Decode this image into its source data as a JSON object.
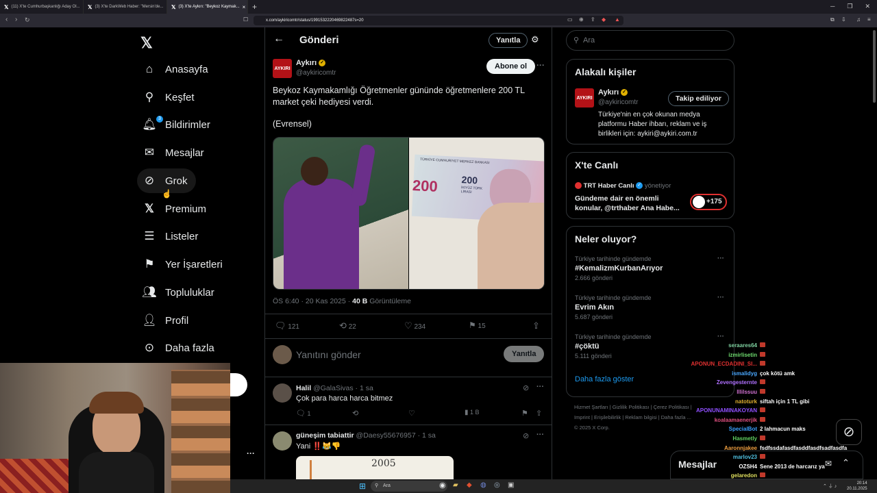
{
  "browser": {
    "tabs": [
      {
        "title": "(11) X'te Cumhurbaşkanlığı Aday Ol..."
      },
      {
        "title": "(3) X'te DarkWeb Haber: \"Mersin'de..."
      },
      {
        "title": "(3) X'te Aykırı: \"Beykoz Kaymak...",
        "active": true
      }
    ],
    "url": "x.com/aykiricomtr/status/1991532220469822487s=20",
    "new_tab": "+"
  },
  "nav": {
    "items": [
      {
        "label": "Anasayfa",
        "icon": "home-icon"
      },
      {
        "label": "Keşfet",
        "icon": "search-icon"
      },
      {
        "label": "Bildirimler",
        "icon": "bell-icon",
        "badge": "3"
      },
      {
        "label": "Mesajlar",
        "icon": "mail-icon"
      },
      {
        "label": "Grok",
        "icon": "grok-icon"
      },
      {
        "label": "Premium",
        "icon": "x-logo-icon"
      },
      {
        "label": "Listeler",
        "icon": "list-icon"
      },
      {
        "label": "Yer İşaretleri",
        "icon": "bookmark-icon"
      },
      {
        "label": "Topluluklar",
        "icon": "community-icon"
      },
      {
        "label": "Profil",
        "icon": "person-icon"
      },
      {
        "label": "Daha fazla",
        "icon": "more-circle-icon"
      }
    ]
  },
  "header": {
    "title": "Gönderi",
    "reply_btn": "Yanıtla"
  },
  "post": {
    "author": "Aykırı",
    "handle": "@aykiricomtr",
    "follow_btn": "Abone ol",
    "text": "Beykoz Kaymakamlığı Öğretmenler gününde öğretmenlere 200 TL market çeki hediyesi verdi.",
    "source": "(Evrensel)",
    "timestamp": "ÖS 6:40 · 20 Kas 2025 · ",
    "views": "40 B",
    "views_label": "Görüntüleme",
    "stats": {
      "replies": "121",
      "reposts": "22",
      "likes": "234",
      "bookmarks": "15"
    },
    "image_banknote_text": "TÜRKİYE CUMHURİYET MERKEZ BANKASI",
    "image_banknote_value": "200",
    "image_banknote_words": "İKİYÜZ TÜRK LİRASI",
    "logo_text": "AYKIRI"
  },
  "compose": {
    "placeholder": "Yanıtını gönder",
    "button": "Yanıtla"
  },
  "replies": [
    {
      "name": "Halil",
      "handle": "@GalaSivas",
      "time": "· 1 sa",
      "text": "Çok para harca harca bitmez",
      "replies": "1",
      "views": "1 B"
    },
    {
      "name": "güneşim tabiattir",
      "handle": "@Daesy55676957",
      "time": "· 1 sa",
      "text": "Yani ‼️😹👎",
      "image_text": "2005"
    }
  ],
  "search": {
    "placeholder": "Ara"
  },
  "related": {
    "title": "Alakalı kişiler",
    "name": "Aykırı",
    "handle": "@aykiricomtr",
    "follow_btn": "Takip ediliyor",
    "bio": "Türkiye'nin en çok okunan medya platformu Haber ihbarı, reklam ve iş birlikleri için: aykiri@aykiri.com.tr"
  },
  "live": {
    "title": "X'te Canlı",
    "host": "TRT Haber Canlı",
    "role": "yönetiyor",
    "text": "Gündeme dair en önemli konular, @trthaber Ana Habe...",
    "count": "+175"
  },
  "trends": {
    "title": "Neler oluyor?",
    "items": [
      {
        "sub": "Türkiye tarihinde gündemde",
        "title": "#KemalizmKurbanArıyor",
        "count": "2.666 gönderi"
      },
      {
        "sub": "Türkiye tarihinde gündemde",
        "title": "Evrim Akın",
        "count": "5.687 gönderi"
      },
      {
        "sub": "Türkiye tarihinde gündemde",
        "title": "#çöktü",
        "count": "5.111 gönderi"
      }
    ],
    "more": "Daha fazla göster"
  },
  "footer": {
    "links": [
      "Hizmet Şartları",
      "Gizlilik Politikası",
      "Çerez Politikası",
      "Imprint",
      "Erişilebilirlik",
      "Reklam bilgisi",
      "Daha fazla ..."
    ],
    "copyright": "© 2025 X Corp."
  },
  "messages_bar": {
    "label": "Mesajlar"
  },
  "chat": [
    {
      "name": "seraares64",
      "msg": "",
      "color": "#7fd1a0"
    },
    {
      "name": "izmirlisetin",
      "msg": "",
      "color": "#6fdc6f"
    },
    {
      "name": "APONUN_ECDADINI_SI...",
      "msg": "",
      "color": "#e03030"
    },
    {
      "name": "ismalidyg",
      "msg": "çok kötü amk",
      "color": "#4aa8ff"
    },
    {
      "name": "Zevengesternte",
      "msg": "",
      "color": "#b070ff"
    },
    {
      "name": "lllilssuu",
      "msg": "",
      "color": "#d070d0"
    },
    {
      "name": "natoturk",
      "msg": "siftah için 1 TL gibi",
      "color": "#e0b030"
    },
    {
      "name": "APONUNAMINAKOYAN",
      "msg": "",
      "color": "#9050ff"
    },
    {
      "name": "koalaamaenerjik",
      "msg": "",
      "color": "#e05080"
    },
    {
      "name": "SpecialBot",
      "msg": "2 lahmacun maks",
      "color": "#3aa0ff"
    },
    {
      "name": "Hasmetly",
      "msg": "",
      "color": "#60d060"
    },
    {
      "name": "Aaronnjakee",
      "msg": "fsdfssdafasdfasddfasdfsadfasdfa",
      "color": "#f0a040"
    },
    {
      "name": "marlov23",
      "msg": "",
      "color": "#50c0e0"
    },
    {
      "name": "OZSH4",
      "msg": "Sene 2013 de harcarız ya",
      "color": "#ffffff"
    },
    {
      "name": "gelaredon",
      "msg": "",
      "color": "#e0e060"
    }
  ],
  "taskbar": {
    "search": "Ara",
    "time": "20:14",
    "date": "20.11.2025"
  },
  "colors": {
    "accent": "#1d9bf0",
    "bg": "#000000",
    "border": "#2f3336",
    "brand_red": "#b31217"
  }
}
